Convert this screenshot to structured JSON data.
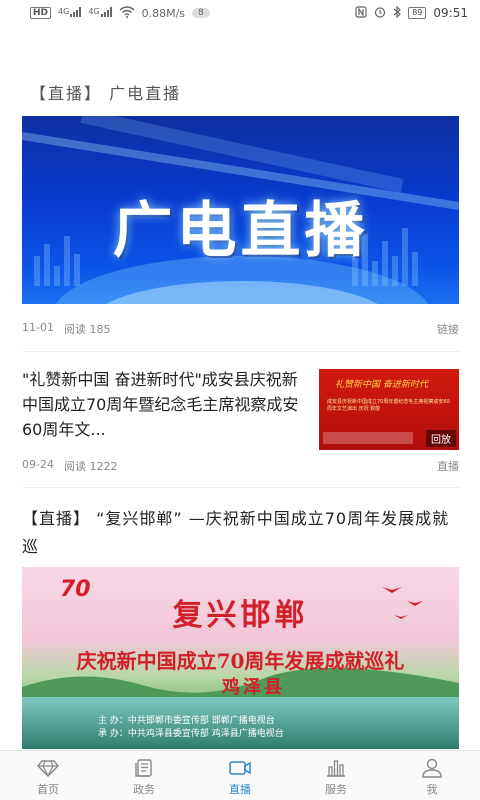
{
  "status_bar": {
    "hd_label": "HD",
    "sim_labels": [
      "4G",
      "4G"
    ],
    "net_speed": "0.88M/s",
    "notification_count": "8",
    "battery": "89",
    "time": "09:51"
  },
  "articles": [
    {
      "title": "【直播】 广电直播",
      "banner_text": "广电直播",
      "date": "11-01",
      "reads": "阅读 185",
      "tag": "链接"
    },
    {
      "title": "\"礼赞新中国 奋进新时代\"成安县庆祝新中国成立70周年暨纪念毛主席视察成安60周年文...",
      "thumb_heading": "礼赞新中国 奋进新时代",
      "thumb_text": "成安县庆祝新中国成立70周年暨纪念毛主席视察成安60周年文艺演出 庆祝 致敬",
      "thumb_badge": "回放",
      "date": "09-24",
      "reads": "阅读 1222",
      "tag": "直播"
    },
    {
      "title": "【直播】 “复兴邯郸” —庆祝新中国成立70周年发展成就巡",
      "image_heading": "复兴邯郸",
      "image_subheading": "庆祝新中国成立70周年发展成就巡礼",
      "image_county": "鸡泽县",
      "image_logo": "70",
      "image_host_1": "主 办：中共邯郸市委宣传部   邯郸广播电视台",
      "image_host_2": "承 办：中共鸡泽县委宣传部   鸡泽县广播电视台"
    }
  ],
  "tabbar": {
    "items": [
      {
        "label": "首页",
        "icon": "diamond-icon"
      },
      {
        "label": "政务",
        "icon": "document-icon"
      },
      {
        "label": "直播",
        "icon": "video-camera-icon"
      },
      {
        "label": "服务",
        "icon": "bar-chart-icon"
      },
      {
        "label": "我",
        "icon": "user-icon"
      }
    ],
    "active_index": 2,
    "active_color": "#2d88c8",
    "inactive_color": "#888888"
  }
}
